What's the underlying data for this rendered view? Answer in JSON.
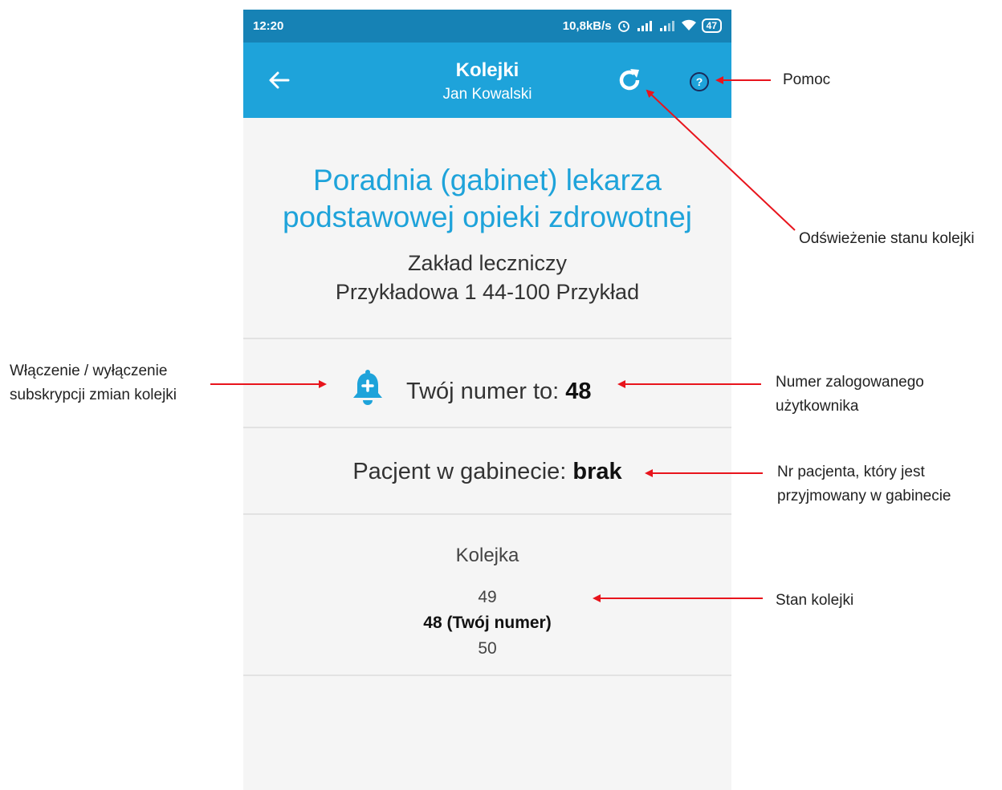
{
  "statusbar": {
    "time": "12:20",
    "speed": "10,8kB/s",
    "battery": "47"
  },
  "appbar": {
    "title": "Kolejki",
    "subtitle": "Jan Kowalski",
    "back_icon": "arrow-left-icon",
    "refresh_icon": "refresh-icon",
    "help_icon": "help-circle-icon"
  },
  "clinic": {
    "name_line1": "Poradnia (gabinet) lekarza",
    "name_line2": "podstawowej opieki zdrowotnej",
    "facility": "Zakład leczniczy",
    "address": "Przykładowa 1 44-100 Przykład"
  },
  "my_number": {
    "label": "Twój numer to: ",
    "value": "48",
    "bell_icon": "bell-plus-icon"
  },
  "in_room": {
    "label": "Pacjent w gabinecie: ",
    "value": "brak"
  },
  "queue": {
    "label": "Kolejka",
    "items": [
      {
        "text": "49",
        "mine": false
      },
      {
        "text": "48 (Twój numer)",
        "mine": true
      },
      {
        "text": "50",
        "mine": false
      }
    ]
  },
  "annotations": {
    "help": "Pomoc",
    "refresh": "Odświeżenie stanu kolejki",
    "subscribe_line1": "Włączenie / wyłączenie",
    "subscribe_line2": "subskrypcji zmian kolejki",
    "user_number_line1": "Numer zalogowanego",
    "user_number_line2": "użytkownika",
    "patient_line1": "Nr pacjenta, który jest",
    "patient_line2": "przyjmowany w gabinecie",
    "queue_state": "Stan kolejki"
  },
  "colors": {
    "statusbar": "#1682b5",
    "appbar": "#1ea3da",
    "accent": "#1ea3da",
    "arrow": "#e8141c"
  }
}
